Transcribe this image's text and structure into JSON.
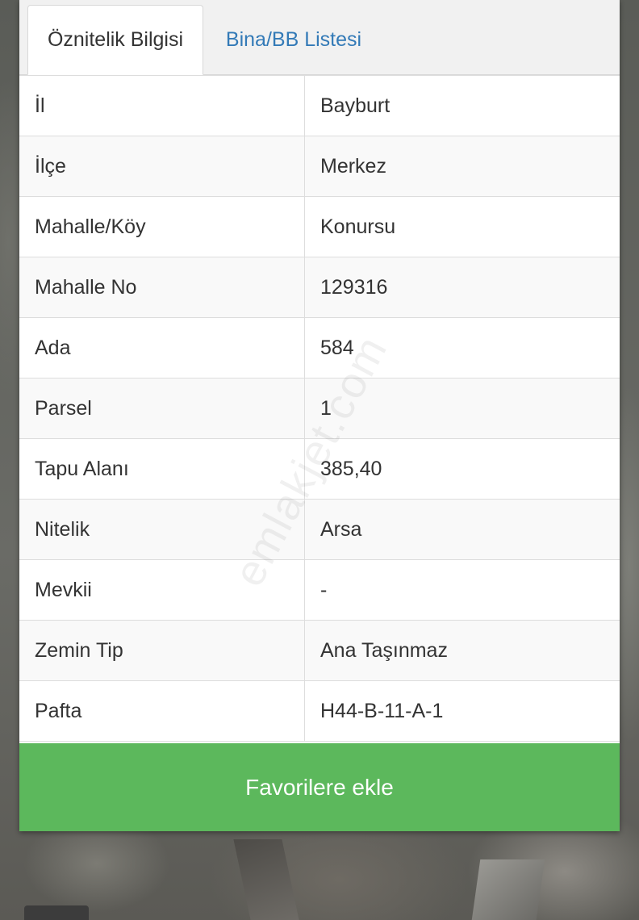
{
  "tabs": [
    {
      "label": "Öznitelik Bilgisi",
      "active": true
    },
    {
      "label": "Bina/BB Listesi",
      "active": false
    }
  ],
  "attributes": [
    {
      "label": "İl",
      "value": "Bayburt"
    },
    {
      "label": "İlçe",
      "value": "Merkez"
    },
    {
      "label": "Mahalle/Köy",
      "value": "Konursu"
    },
    {
      "label": "Mahalle No",
      "value": "129316"
    },
    {
      "label": "Ada",
      "value": "584"
    },
    {
      "label": "Parsel",
      "value": "1"
    },
    {
      "label": "Tapu Alanı",
      "value": "385,40"
    },
    {
      "label": "Nitelik",
      "value": "Arsa"
    },
    {
      "label": "Mevkii",
      "value": "-"
    },
    {
      "label": "Zemin Tip",
      "value": "Ana Taşınmaz"
    },
    {
      "label": "Pafta",
      "value": "H44-B-11-A-1"
    }
  ],
  "favorite_button": {
    "label": "Favorilere ekle"
  },
  "watermark": "emlakjet.com",
  "colors": {
    "active_tab_text": "#333333",
    "inactive_tab_text": "#337ab7",
    "button_bg": "#5cb85c",
    "button_text": "#ffffff"
  }
}
